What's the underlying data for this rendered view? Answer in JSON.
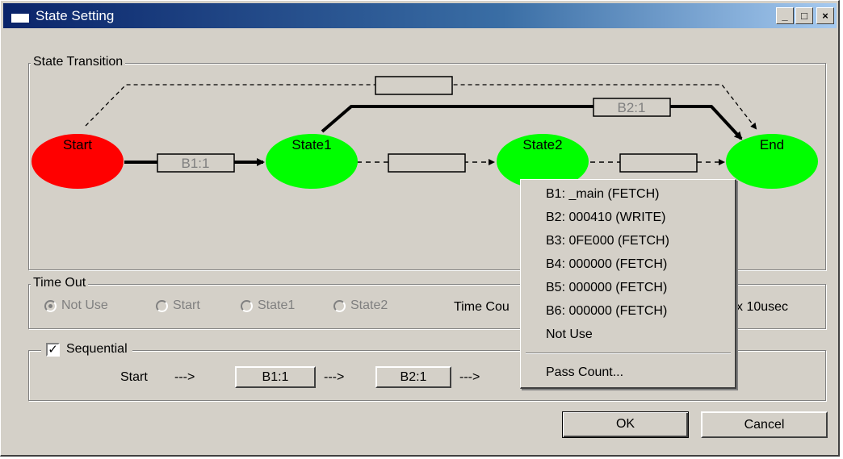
{
  "window": {
    "title": "State Setting"
  },
  "titlebar_buttons": {
    "minimize": "_",
    "maximize": "□",
    "close": "×"
  },
  "state_transition": {
    "label": "State Transition",
    "states": {
      "start": "Start",
      "state1": "State1",
      "state2": "State2",
      "end": "End"
    },
    "colors": {
      "start": "#ff0000",
      "active": "#00ff00"
    },
    "transitions": {
      "start_to_state1": "B1:1",
      "state1_to_state2": "",
      "state2_to_end": "",
      "start_to_end": "",
      "state1_to_end": "B2:1"
    }
  },
  "time_out": {
    "label": "Time Out",
    "options": [
      "Not Use",
      "Start",
      "State1",
      "State2"
    ],
    "selected": "Not Use",
    "time_count_label": "Time Cou",
    "unit": "x 10usec"
  },
  "sequential": {
    "label": "Sequential",
    "checked": true,
    "check_mark": "✓",
    "start_label": "Start",
    "arrow": "--->",
    "steps": [
      "B1:1",
      "B2:1"
    ]
  },
  "context_menu": {
    "items": [
      "B1: _main (FETCH)",
      "B2: 000410 (WRITE)",
      "B3: 0FE000 (FETCH)",
      "B4: 000000 (FETCH)",
      "B5: 000000 (FETCH)",
      "B6: 000000 (FETCH)",
      "Not Use"
    ],
    "footer": "Pass Count..."
  },
  "buttons": {
    "ok": "OK",
    "cancel": "Cancel"
  }
}
